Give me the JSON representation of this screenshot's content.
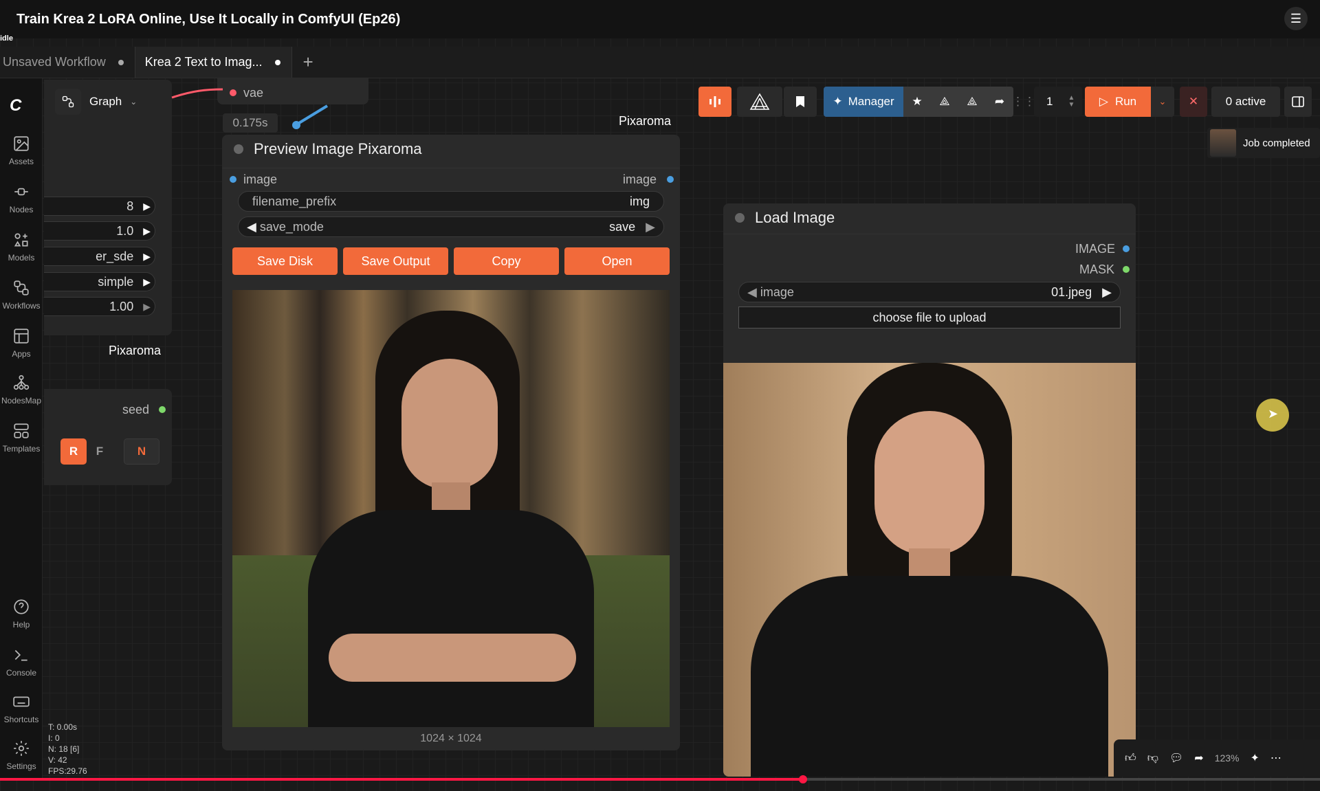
{
  "video": {
    "title": "Train Krea 2 LoRA Online, Use It Locally in ComfyUI (Ep26)",
    "status": "idle"
  },
  "tabs": [
    {
      "label": "Unsaved Workflow"
    },
    {
      "label": "Krea 2 Text to Imag..."
    }
  ],
  "sidebar": {
    "items": [
      {
        "label": "Assets",
        "icon": "image-icon"
      },
      {
        "label": "Nodes",
        "icon": "nodes-icon"
      },
      {
        "label": "Models",
        "icon": "models-icon"
      },
      {
        "label": "Workflows",
        "icon": "workflow-icon"
      },
      {
        "label": "Apps",
        "icon": "apps-icon"
      },
      {
        "label": "NodesMap",
        "icon": "nodesmap-icon"
      },
      {
        "label": "Templates",
        "icon": "templates-icon"
      },
      {
        "label": "Help",
        "icon": "help-icon"
      },
      {
        "label": "Console",
        "icon": "console-icon"
      },
      {
        "label": "Shortcuts",
        "icon": "keyboard-icon"
      },
      {
        "label": "Settings",
        "icon": "gear-icon"
      }
    ]
  },
  "graph_button": {
    "label": "Graph"
  },
  "left_node": {
    "widgets": [
      "8",
      "1.0",
      "er_sde",
      "simple",
      "1.00"
    ],
    "seed_label": "seed",
    "rfn": [
      "R",
      "F",
      "N"
    ]
  },
  "vae_label": "vae",
  "timing": "0.175s",
  "group_labels": [
    "Pixaroma",
    "Pixaroma"
  ],
  "preview_node": {
    "title": "Preview Image Pixaroma",
    "input_label": "image",
    "output_label": "image",
    "filename_prefix": {
      "label": "filename_prefix",
      "value": "img"
    },
    "save_mode": {
      "label": "save_mode",
      "value": "save"
    },
    "buttons": [
      "Save Disk",
      "Save Output",
      "Copy",
      "Open"
    ],
    "dims": "1024 × 1024"
  },
  "toolbar": {
    "manager": "Manager",
    "queue_count": "1",
    "run": "Run",
    "active": "0 active"
  },
  "notification": "Job completed",
  "load_node": {
    "title": "Load Image",
    "outputs": [
      "IMAGE",
      "MASK"
    ],
    "image_label": "image",
    "image_value": "01.jpeg",
    "upload_label": "choose file to upload"
  },
  "stats": [
    "T: 0.00s",
    "I: 0",
    "N: 18 [6]",
    "V: 42",
    "FPS:29.76"
  ],
  "zoom": "123%",
  "colors": {
    "accent": "#f26a3a",
    "manager": "#2c5f8f",
    "socket_blue": "#4a9ee0",
    "socket_green": "#7ed86a"
  }
}
